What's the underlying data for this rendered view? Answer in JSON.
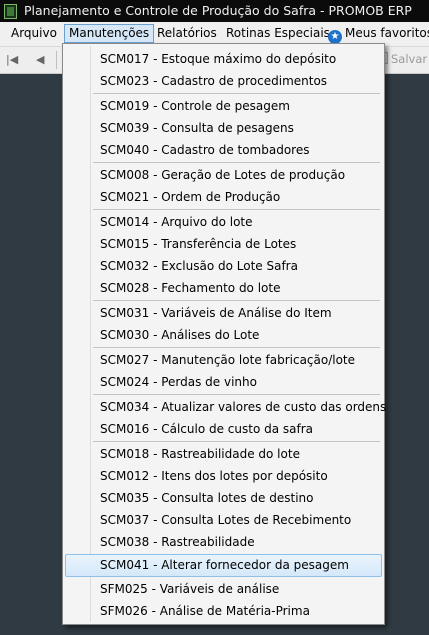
{
  "window": {
    "title": "Planejamento e Controle de Produção do Safra - PROMOB ERP"
  },
  "menubar": {
    "items": [
      {
        "label": "Arquivo"
      },
      {
        "label": "Manutenções"
      },
      {
        "label": "Relatórios"
      },
      {
        "label": "Rotinas Especiais"
      },
      {
        "label": "Meus favoritos"
      }
    ]
  },
  "toolbar": {
    "save_label": "Salvar"
  },
  "dropdown": {
    "items": [
      {
        "label": "SCM017 - Estoque máximo do depósito"
      },
      {
        "label": "SCM023 - Cadastro de procedimentos"
      },
      {
        "label": "SCM019 - Controle de pesagem"
      },
      {
        "label": "SCM039 - Consulta de pesagens"
      },
      {
        "label": "SCM040 - Cadastro de tombadores"
      },
      {
        "label": "SCM008 - Geração de Lotes de produção"
      },
      {
        "label": "SCM021 - Ordem de Produção"
      },
      {
        "label": "SCM014 - Arquivo do lote"
      },
      {
        "label": "SCM015 - Transferência de Lotes"
      },
      {
        "label": "SCM032 - Exclusão do Lote Safra"
      },
      {
        "label": "SCM028 - Fechamento do lote"
      },
      {
        "label": "SCM031 - Variáveis de Análise do Item"
      },
      {
        "label": "SCM030 - Análises do Lote"
      },
      {
        "label": "SCM027 - Manutenção lote fabricação/lote"
      },
      {
        "label": "SCM024 - Perdas de vinho"
      },
      {
        "label": "SCM034 - Atualizar valores de custo das ordens"
      },
      {
        "label": "SCM016 - Cálculo de custo da safra"
      },
      {
        "label": "SCM018 - Rastreabilidade do lote"
      },
      {
        "label": "SCM012 - Itens dos lotes por depósito"
      },
      {
        "label": "SCM035 - Consulta lotes de destino"
      },
      {
        "label": "SCM037 - Consulta Lotes de Recebimento"
      },
      {
        "label": "SCM038 - Rastreabilidade"
      },
      {
        "label": "SCM041 - Alterar fornecedor da pesagem"
      },
      {
        "label": "SFM025 - Variáveis de análise"
      },
      {
        "label": "SFM026 - Análise de Matéria-Prima"
      }
    ]
  }
}
